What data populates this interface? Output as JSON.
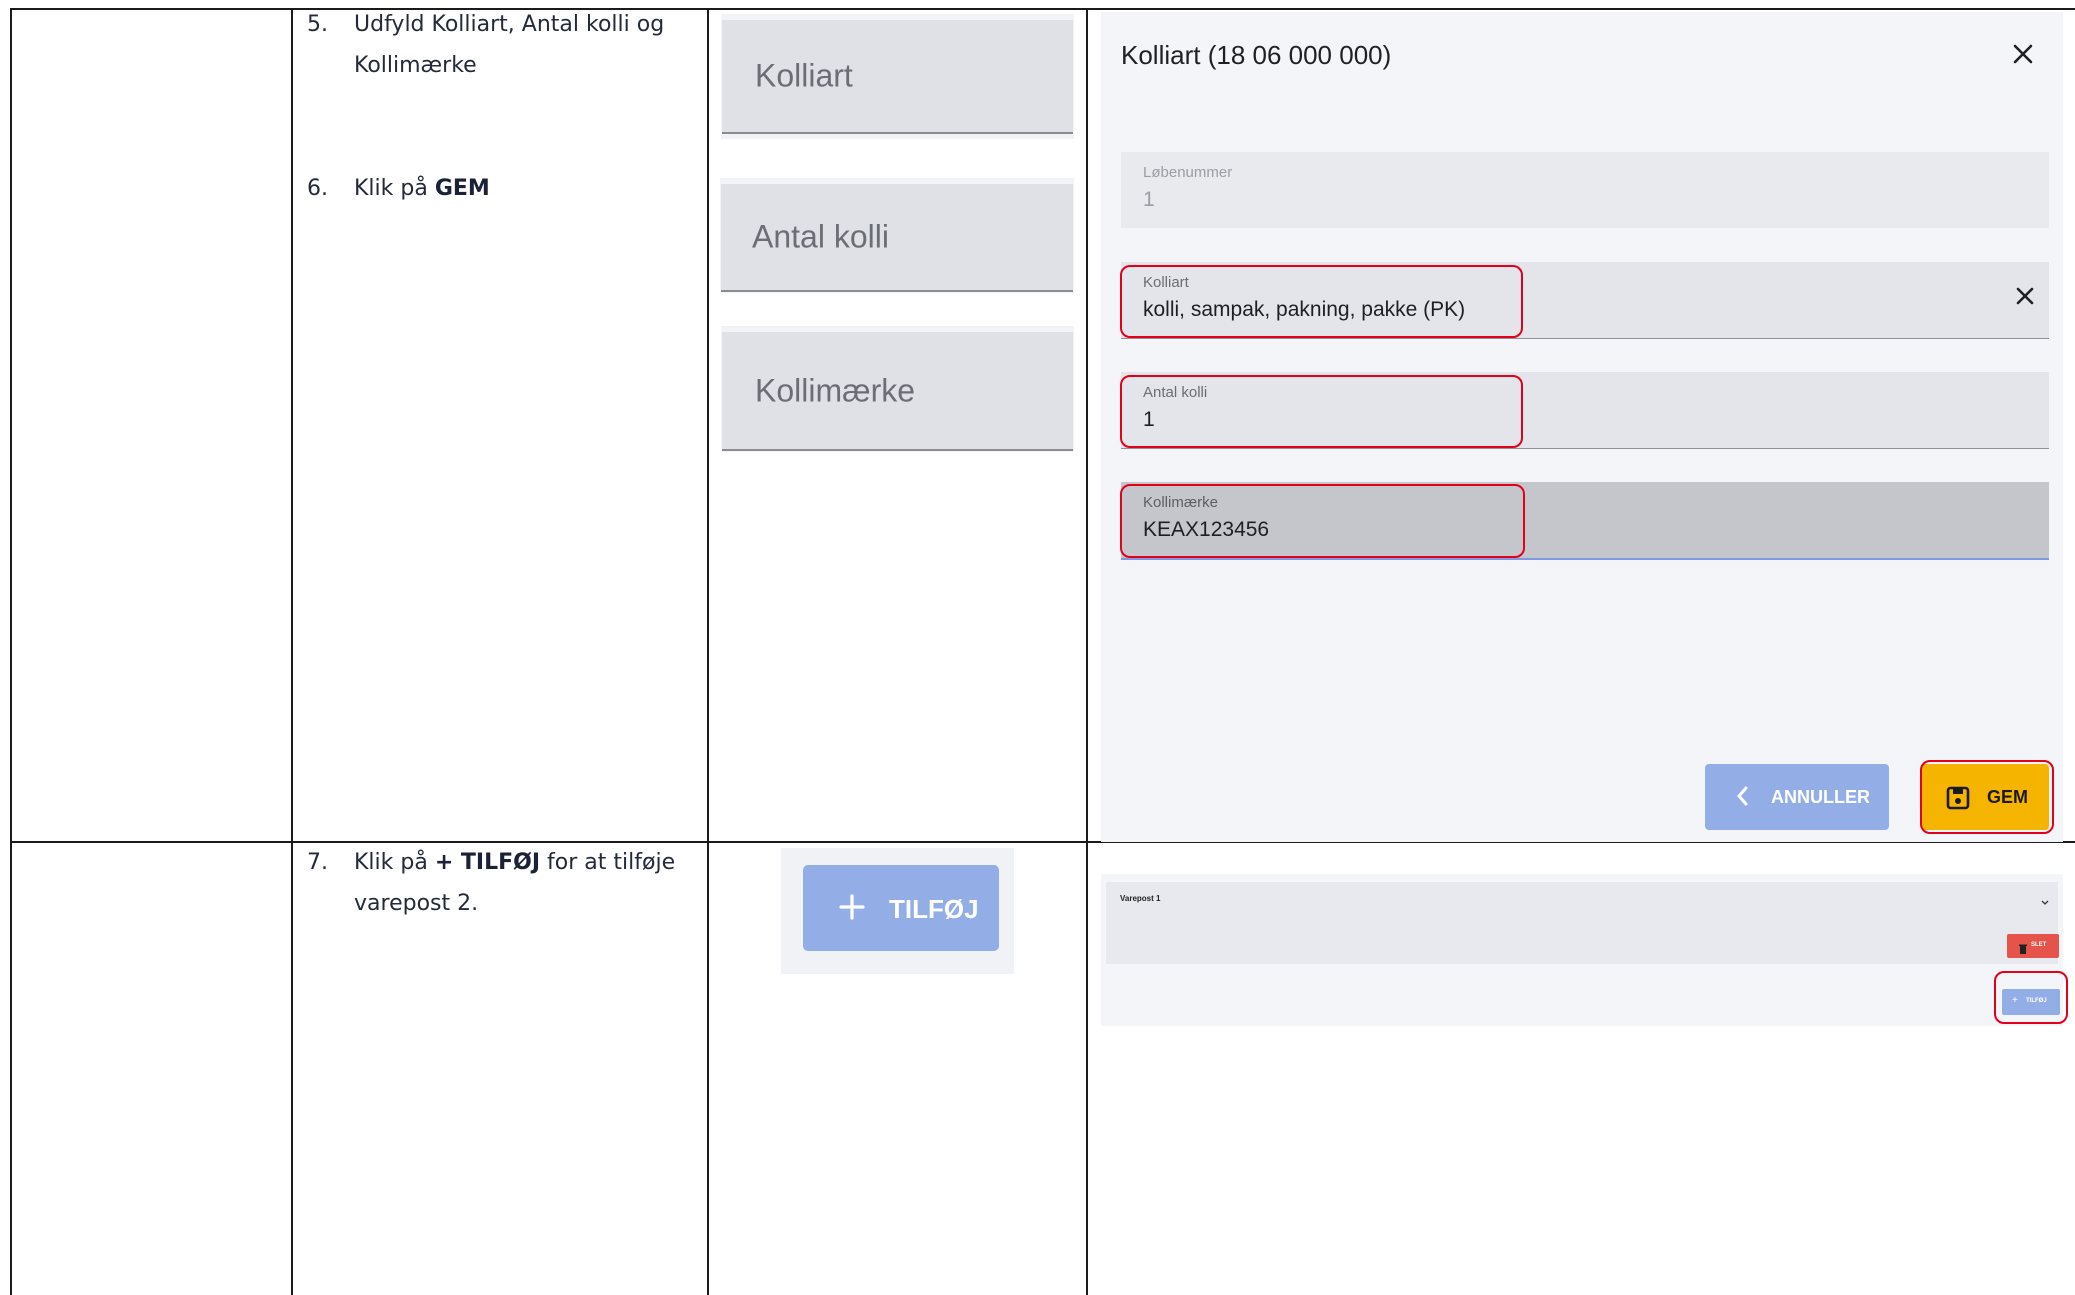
{
  "steps": {
    "s5_num": "5.",
    "s5_line1": "Udfyld Kolliart, Antal kolli og",
    "s5_line2": "Kollimærke",
    "s6_num": "6.",
    "s6_pre": "Klik på ",
    "s6_bold": "GEM",
    "s7_num": "7.",
    "s7_pre": "Klik på ",
    "s7_bold": "+ TILFØJ",
    "s7_post": " for at tilføje",
    "s7_line2": "varepost 2."
  },
  "crops": {
    "kolliart": "Kolliart",
    "antal_kolli": "Antal kolli",
    "kollimaerke": "Kollimærke",
    "tilfoj": "TILFØJ"
  },
  "dialog": {
    "title": "Kolliart (18 06 000 000)",
    "fields": {
      "lobenummer": {
        "label": "Løbenummer",
        "value": "1"
      },
      "kolliart": {
        "label": "Kolliart",
        "value": "kolli, sampak, pakning, pakke (PK)"
      },
      "antal_kolli": {
        "label": "Antal kolli",
        "value": "1"
      },
      "kollimaerke": {
        "label": "Kollimærke",
        "value": "KEAX123456"
      }
    },
    "annuller": "ANNULLER",
    "gem": "GEM"
  },
  "varepost": {
    "title": "Varepost 1",
    "slet": "SLET",
    "tilfoj": "TILFØJ"
  },
  "colors": {
    "highlight": "#e2001a",
    "primary_button": "#93aee6",
    "gem_button": "#f5b400",
    "delete_button": "#e5534b"
  }
}
